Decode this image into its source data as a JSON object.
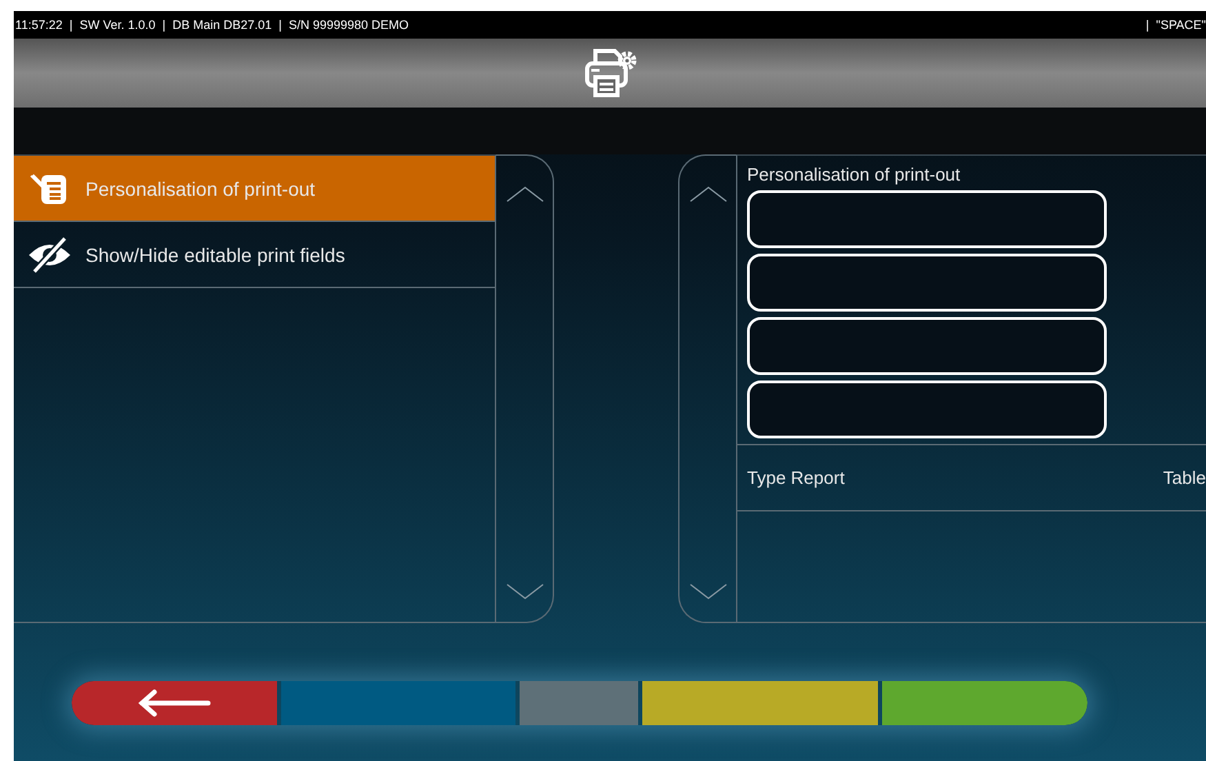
{
  "status_bar": {
    "left": "11:57:22  |  SW Ver. 1.0.0  |  DB Main DB27.01  |  S/N 99999980 DEMO",
    "right": "|  \"SPACE\""
  },
  "menu": {
    "items": [
      {
        "label": "Personalisation of print-out",
        "kind": "document",
        "selected": true
      },
      {
        "label": "Show/Hide editable print fields",
        "kind": "hidden",
        "selected": false
      }
    ]
  },
  "detail": {
    "title": "Personalisation of print-out",
    "fields": [
      {
        "kind": "text"
      },
      {
        "kind": "text"
      },
      {
        "kind": "text"
      },
      {
        "kind": "text"
      }
    ],
    "settings": [
      {
        "label": "Type Report",
        "value": "Table"
      }
    ]
  },
  "toolbar": [
    {
      "kind": "back",
      "color": "#b8272a"
    },
    {
      "kind": "blank",
      "color": "#005a82"
    },
    {
      "kind": "blank",
      "color": "#5e7078"
    },
    {
      "kind": "blank",
      "color": "#b8aa26"
    },
    {
      "kind": "blank",
      "color": "#5ea82e"
    }
  ]
}
